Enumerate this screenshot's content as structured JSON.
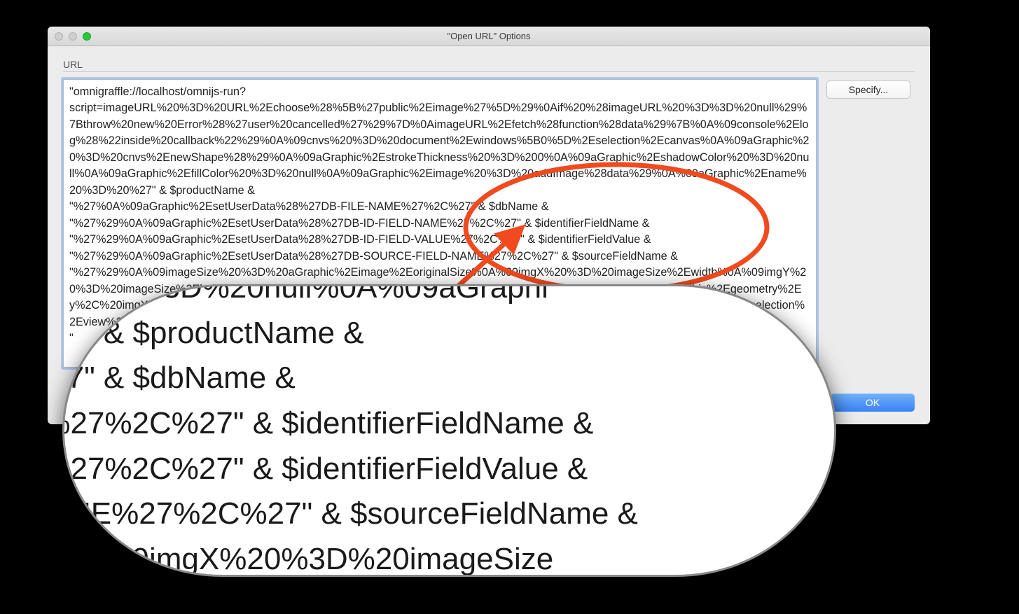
{
  "window": {
    "title": "\"Open URL\" Options",
    "url_label": "URL",
    "specify_label": "Specify...",
    "ok_label": "OK",
    "url_value": "\"omnigraffle://localhost/omnijs-run?\nscript=imageURL%20%3D%20URL%2Echoose%28%5B%27public%2Eimage%27%5D%29%0Aif%20%28imageURL%20%3D%3D%20null%29%7Bthrow%20new%20Error%28%27user%20cancelled%27%29%7D%0AimageURL%2Efetch%28function%28data%29%7B%0A%09console%2Elog%28%22inside%20callback%22%29%0A%09cnvs%20%3D%20document%2Ewindows%5B0%5D%2Eselection%2Ecanvas%0A%09aGraphic%20%3D%20cnvs%2EnewShape%28%29%0A%09aGraphic%2EstrokeThickness%20%3D%200%0A%09aGraphic%2EshadowColor%20%3D%20null%0A%09aGraphic%2EfillColor%20%3D%20null%0A%09aGraphic%2Eimage%20%3D%20addImage%28data%29%0A%09aGraphic%2Ename%20%3D%20%27\" & $productName & \n\"%27%0A%09aGraphic%2EsetUserData%28%27DB-FILE-NAME%27%2C%27\" & $dbName & \n\"%27%29%0A%09aGraphic%2EsetUserData%28%27DB-ID-FIELD-NAME%27%2C%27\" & $identifierFieldName & \n\"%27%29%0A%09aGraphic%2EsetUserData%28%27DB-ID-FIELD-VALUE%27%2C%27\" & $identifierFieldValue & \n\"%27%29%0A%09aGraphic%2EsetUserData%28%27DB-SOURCE-FIELD-NAME%27%2C%27\" & $sourceFieldName & \n\"%27%29%0A%09imageSize%20%3D%20aGraphic%2Eimage%2EoriginalSize%0A%09imgX%20%3D%20imageSize%2Ewidth%0A%09imgY%20%3D%20imageSize%2Eheight%0A%09aRect%20%3D%20new%20Rect%28aGraphic%2Egeometry%2Ex%2C%20aGraphic%2Egeometry%2Ey%2C%20imgX%2C%20imgY%29%0A%09aGraphic%2Egeometry%20%3D%20aRect%0A%09document%2Ewindows%5B0%5D%2Eselection%2Eview%2Eselect%28%5BaGraphic%5D%29%0A%7D%29\n\""
  },
  "magnifier": {
    "content": "olor%20%3D%20null%0A%09aGraphi\n%27\" & $productName &\n%27\" & $dbName &\nE%27%2C%27\" & $identifierFieldName &\nE%27%2C%27\" & $identifierFieldValue &\nNAME%27%2C%27\" & $sourceFieldName &\n%0A%09imgX%20%3D%20imageSize"
  }
}
